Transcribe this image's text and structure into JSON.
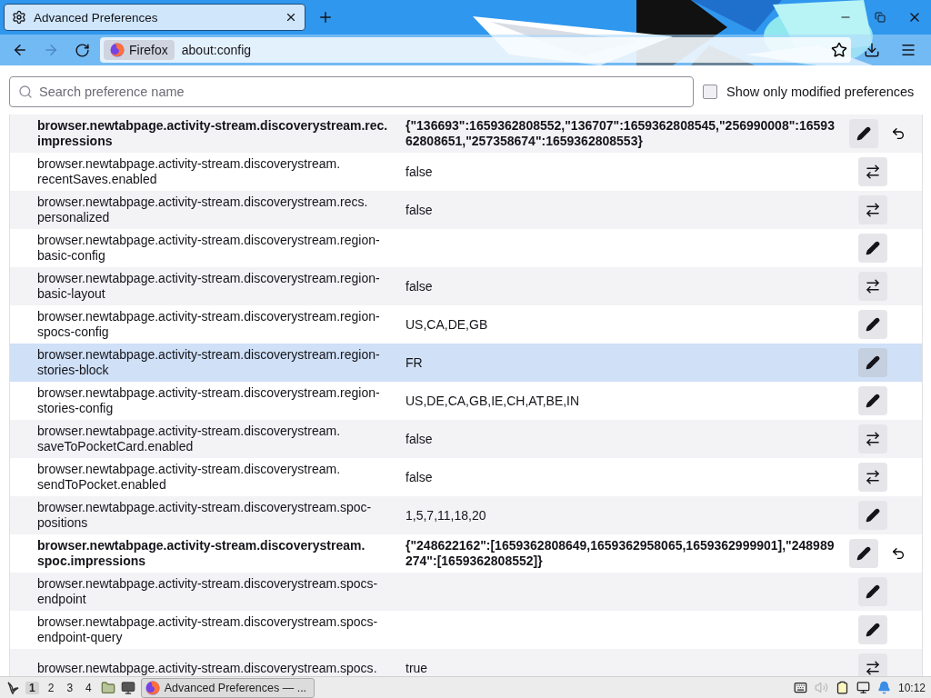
{
  "tabs": [
    {
      "title": "Advanced Preferences",
      "selected": true
    }
  ],
  "toolbar": {
    "back": {
      "disabled": false
    },
    "forward": {
      "disabled": true
    },
    "identity": "Firefox",
    "url": "about:config"
  },
  "search": {
    "placeholder": "Search preference name"
  },
  "filter": {
    "label": "Show only modified preferences",
    "checked": false
  },
  "prefs": [
    {
      "name": "browser.newtabpage.activity-stream.discoverystream.rec.impressions",
      "value": "{\"136693\":1659362808552,\"136707\":1659362808545,\"256990008\":1659362808651,\"257358674\":1659362808553}",
      "kind": "string",
      "modified": true,
      "selected": false
    },
    {
      "name": "browser.newtabpage.activity-stream.discoverystream.recentSaves.enabled",
      "value": "false",
      "kind": "bool",
      "modified": false,
      "selected": false
    },
    {
      "name": "browser.newtabpage.activity-stream.discoverystream.recs.personalized",
      "value": "false",
      "kind": "bool",
      "modified": false,
      "selected": false
    },
    {
      "name": "browser.newtabpage.activity-stream.discoverystream.region-basic-config",
      "kind": "string",
      "modified": false,
      "selected": false
    },
    {
      "name": "browser.newtabpage.activity-stream.discoverystream.region-basic-layout",
      "value": "false",
      "kind": "bool",
      "modified": false,
      "selected": false
    },
    {
      "name": "browser.newtabpage.activity-stream.discoverystream.region-spocs-config",
      "value": "US,CA,DE,GB",
      "kind": "string",
      "modified": false,
      "selected": false
    },
    {
      "name": "browser.newtabpage.activity-stream.discoverystream.region-stories-block",
      "value": "FR",
      "kind": "string",
      "modified": false,
      "selected": true
    },
    {
      "name": "browser.newtabpage.activity-stream.discoverystream.region-stories-config",
      "value": "US,DE,CA,GB,IE,CH,AT,BE,IN",
      "kind": "string",
      "modified": false,
      "selected": false
    },
    {
      "name": "browser.newtabpage.activity-stream.discoverystream.saveToPocketCard.enabled",
      "value": "false",
      "kind": "bool",
      "modified": false,
      "selected": false
    },
    {
      "name": "browser.newtabpage.activity-stream.discoverystream.sendToPocket.enabled",
      "value": "false",
      "kind": "bool",
      "modified": false,
      "selected": false
    },
    {
      "name": "browser.newtabpage.activity-stream.discoverystream.spoc-positions",
      "value": "1,5,7,11,18,20",
      "kind": "string",
      "modified": false,
      "selected": false
    },
    {
      "name": "browser.newtabpage.activity-stream.discoverystream.spoc.impressions",
      "value": "{\"248622162\":[1659362808649,1659362958065,1659362999901],\"248989274\":[1659362808552]}",
      "kind": "string",
      "modified": true,
      "selected": false
    },
    {
      "name": "browser.newtabpage.activity-stream.discoverystream.spocs-endpoint",
      "kind": "string",
      "modified": false,
      "selected": false
    },
    {
      "name": "browser.newtabpage.activity-stream.discoverystream.spocs-endpoint-query",
      "kind": "string",
      "modified": false,
      "selected": false
    },
    {
      "name": "browser.newtabpage.activity-stream.discoverystream.spocs.",
      "value": "true",
      "kind": "bool",
      "modified": false,
      "selected": false
    }
  ],
  "taskbar": {
    "workspaces": [
      {
        "label": "1",
        "selected": true
      },
      {
        "label": "2",
        "selected": false
      },
      {
        "label": "3",
        "selected": false
      },
      {
        "label": "4",
        "selected": false
      }
    ],
    "task": "Advanced Preferences — ...",
    "clock": "10:12"
  }
}
